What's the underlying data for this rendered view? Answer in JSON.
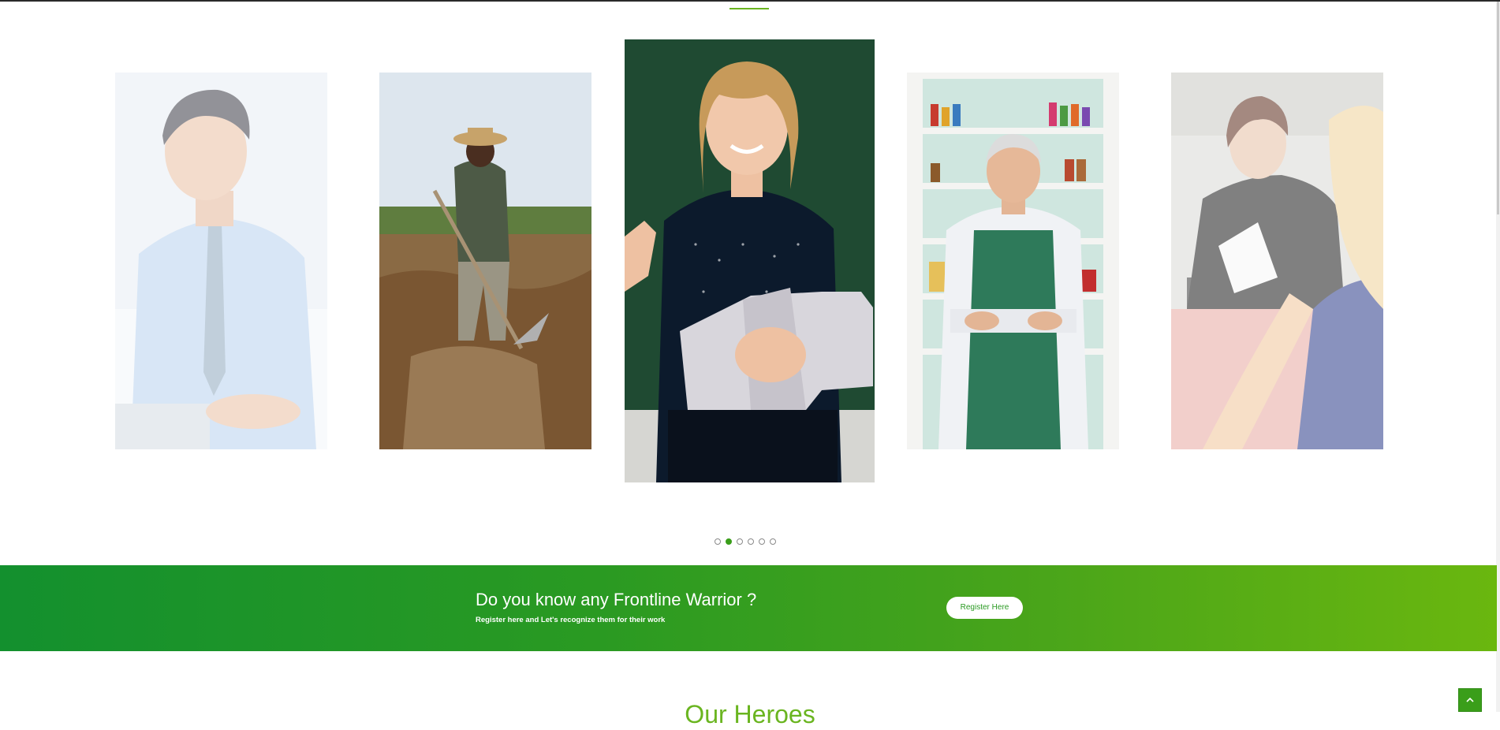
{
  "carousel": {
    "slides": [
      {
        "name": "businessman-on-tablet",
        "state": "inactive"
      },
      {
        "name": "farmer-with-hoe",
        "state": "inactive"
      },
      {
        "name": "teacher-with-book",
        "state": "active"
      },
      {
        "name": "shopkeeper-in-apron",
        "state": "inactive"
      },
      {
        "name": "women-at-desk",
        "state": "inactive"
      }
    ],
    "dots": {
      "count": 6,
      "active_index": 1
    }
  },
  "cta": {
    "title": "Do you know any Frontline Warrior ?",
    "subtitle": "Register here and Let's recognize them for their work",
    "button_label": "Register Here"
  },
  "heroes": {
    "heading": "Our Heroes"
  },
  "colors": {
    "accent_green": "#6ab520",
    "banner_start": "#13902e",
    "banner_end": "#6ab70f",
    "dot_active": "#3a9e1a"
  },
  "icons": {
    "back_to_top": "chevron-up-icon"
  }
}
